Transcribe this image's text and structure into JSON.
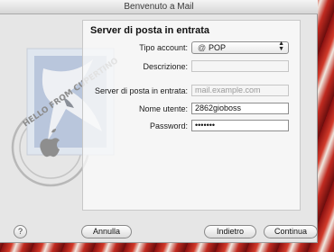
{
  "window": {
    "title": "Benvenuto a Mail"
  },
  "panel": {
    "title": "Server di posta in entrata"
  },
  "form": {
    "account_type": {
      "label": "Tipo account:",
      "value": "POP",
      "icon": "at-icon"
    },
    "description": {
      "label": "Descrizione:",
      "value": ""
    },
    "server": {
      "label": "Server di posta in entrata:",
      "placeholder": "mail.example.com"
    },
    "username": {
      "label": "Nome utente:",
      "value": "2862gioboss"
    },
    "password": {
      "label": "Password:",
      "value": "•••••••"
    }
  },
  "buttons": {
    "help": "?",
    "cancel": "Annulla",
    "back": "Indietro",
    "continue": "Continua"
  },
  "stamp": {
    "text": "HELLO FROM CUPERTINO"
  }
}
